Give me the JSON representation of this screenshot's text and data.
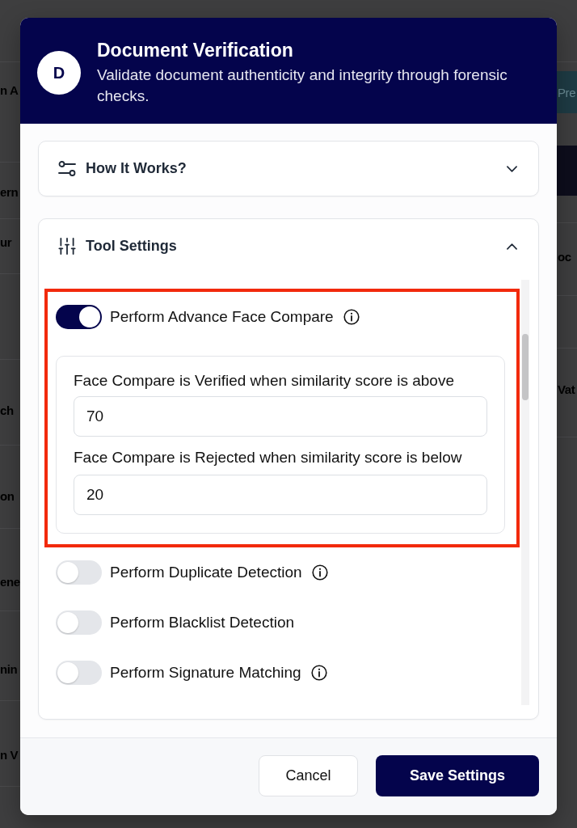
{
  "backdrop": {
    "left_fragments": [
      "n A",
      "ern",
      "ur",
      "ch",
      "on",
      "ene",
      "nin",
      "n V"
    ],
    "right_button": "Pre",
    "right_fragments": [
      "oc",
      "Vat"
    ]
  },
  "dialog": {
    "avatar_letter": "D",
    "title": "Document Verification",
    "subtitle": "Validate document authenticity and integrity through forensic checks."
  },
  "sections": [
    {
      "kind": "guide",
      "title": "How It Works?",
      "expanded": false
    },
    {
      "kind": "settings",
      "title": "Tool Settings",
      "expanded": true,
      "options": [
        {
          "label": "Perform Advance Face Compare",
          "on": true,
          "info": true,
          "highlighted": true,
          "thresholds": [
            {
              "label": "Face Compare is Verified when similarity score is above",
              "value": "70"
            },
            {
              "label": "Face Compare is Rejected when similarity score is below",
              "value": "20"
            }
          ]
        },
        {
          "label": "Perform Duplicate Detection",
          "on": false,
          "info": true,
          "highlighted": false
        },
        {
          "label": "Perform Blacklist Detection",
          "on": false,
          "info": false,
          "highlighted": false
        },
        {
          "label": "Perform Signature Matching",
          "on": false,
          "info": true,
          "highlighted": false
        }
      ]
    }
  ],
  "buttons": [
    {
      "kind": "cancel",
      "label": "Cancel"
    },
    {
      "kind": "save",
      "label": "Save Settings"
    }
  ]
}
